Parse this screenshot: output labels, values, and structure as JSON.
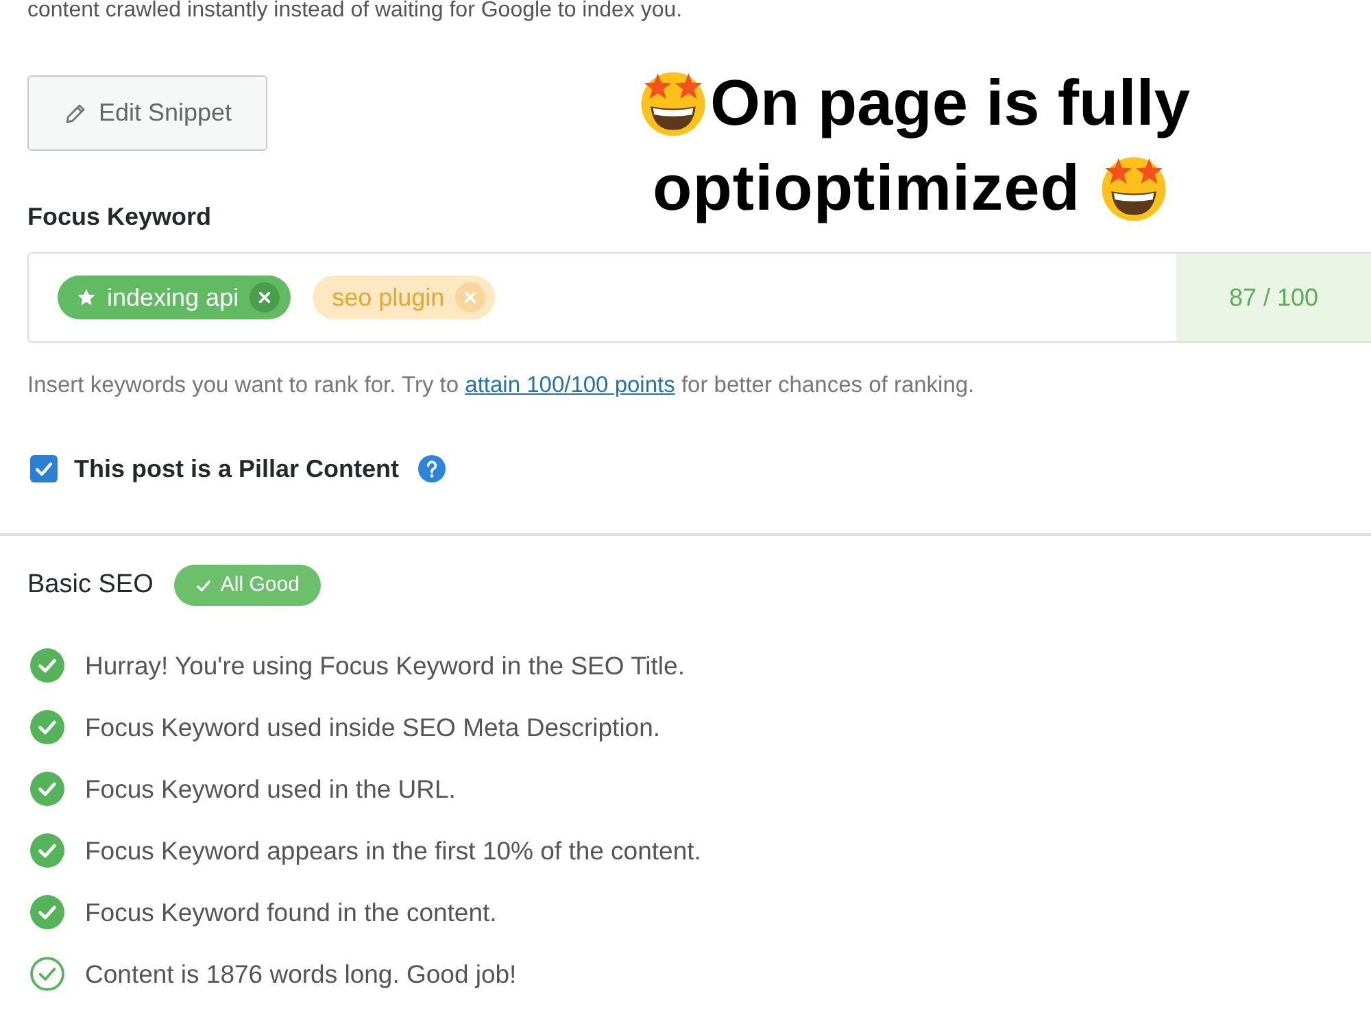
{
  "intro_text": "content crawled instantly instead of waiting for Google to index you.",
  "headline": {
    "lines": [
      "On page is fully",
      "optioptimized"
    ]
  },
  "edit_snippet_button": {
    "label": "Edit Snippet"
  },
  "focus_keyword": {
    "label": "Focus Keyword",
    "keywords": [
      {
        "text": "indexing api",
        "kind": "primary"
      },
      {
        "text": "seo plugin",
        "kind": "secondary"
      }
    ],
    "score": "87 / 100"
  },
  "help_text": {
    "before": "Insert keywords you want to rank for. Try to ",
    "link": "attain 100/100 points",
    "after": " for better chances of ranking."
  },
  "pillar_content": {
    "label": "This post is a Pillar Content",
    "checked": true
  },
  "basic_seo": {
    "title": "Basic SEO",
    "badge": "All Good",
    "checks": [
      {
        "text": "Hurray! You're using Focus Keyword in the SEO Title.",
        "kind": "solid"
      },
      {
        "text": "Focus Keyword used inside SEO Meta Description.",
        "kind": "solid"
      },
      {
        "text": "Focus Keyword used in the URL.",
        "kind": "solid"
      },
      {
        "text": "Focus Keyword appears in the first 10% of the content.",
        "kind": "solid"
      },
      {
        "text": "Focus Keyword found in the content.",
        "kind": "solid"
      },
      {
        "text": "Content is 1876 words long. Good job!",
        "kind": "outline"
      }
    ]
  }
}
